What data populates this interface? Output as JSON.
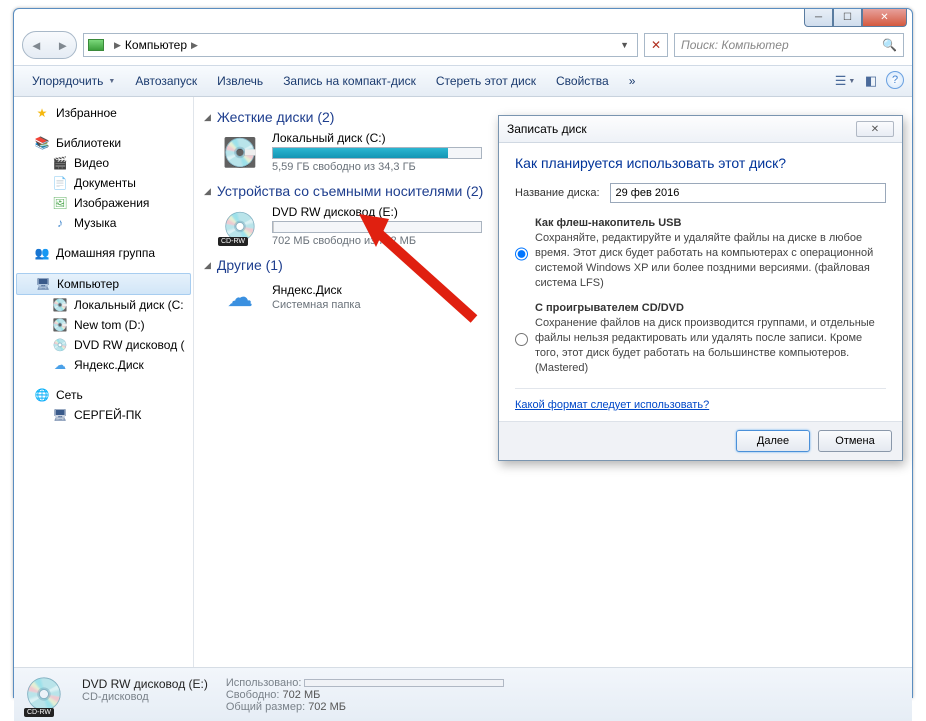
{
  "breadcrumb": {
    "root": "Компьютер"
  },
  "search": {
    "placeholder": "Поиск: Компьютер"
  },
  "toolbar": {
    "organize": "Упорядочить",
    "autoplay": "Автозапуск",
    "eject": "Извлечь",
    "burn": "Запись на компакт-диск",
    "erase": "Стереть этот диск",
    "properties": "Свойства"
  },
  "sidebar": {
    "favorites": "Избранное",
    "libraries": "Библиотеки",
    "lib_items": {
      "video": "Видео",
      "docs": "Документы",
      "images": "Изображения",
      "music": "Музыка"
    },
    "homegroup": "Домашняя группа",
    "computer": "Компьютер",
    "drives": {
      "c": "Локальный диск (C:",
      "d": "New tom (D:)",
      "e": "DVD RW дисковод (",
      "yd": "Яндекс.Диск"
    },
    "network": "Сеть",
    "pc": "СЕРГЕЙ-ПК"
  },
  "sections": {
    "hdd": "Жесткие диски (2)",
    "removable": "Устройства со съемными носителями (2)",
    "other": "Другие (1)"
  },
  "drives": {
    "c": {
      "name": "Локальный диск (C:)",
      "sub": "5,59 ГБ свободно из 34,3 ГБ",
      "fill_pct": 84
    },
    "e": {
      "name": "DVD RW дисковод (E:)",
      "sub": "702 МБ свободно из 702 МБ"
    },
    "yd": {
      "name": "Яндекс.Диск",
      "sub": "Системная папка"
    }
  },
  "status": {
    "name": "DVD RW дисковод (E:)",
    "type": "CD-дисковод",
    "used_k": "Использовано:",
    "free_k": "Свободно:",
    "free_v": "702 МБ",
    "total_k": "Общий размер:",
    "total_v": "702 МБ"
  },
  "dialog": {
    "title": "Записать диск",
    "heading": "Как планируется использовать этот диск?",
    "name_label": "Название диска:",
    "name_value": "29 фев 2016",
    "opt1_title": "Как флеш-накопитель USB",
    "opt1_desc": "Сохраняйте, редактируйте и удаляйте файлы на диске в любое время. Этот диск будет работать на компьютерах с операционной системой Windows XP или более поздними версиями. (файловая система LFS)",
    "opt2_title": "С проигрывателем CD/DVD",
    "opt2_desc": "Сохранение файлов на диск производится группами, и отдельные файлы нельзя редактировать или удалять после записи. Кроме того, этот диск будет работать на большинстве компьютеров. (Mastered)",
    "link": "Какой формат следует использовать?",
    "next": "Далее",
    "cancel": "Отмена"
  }
}
